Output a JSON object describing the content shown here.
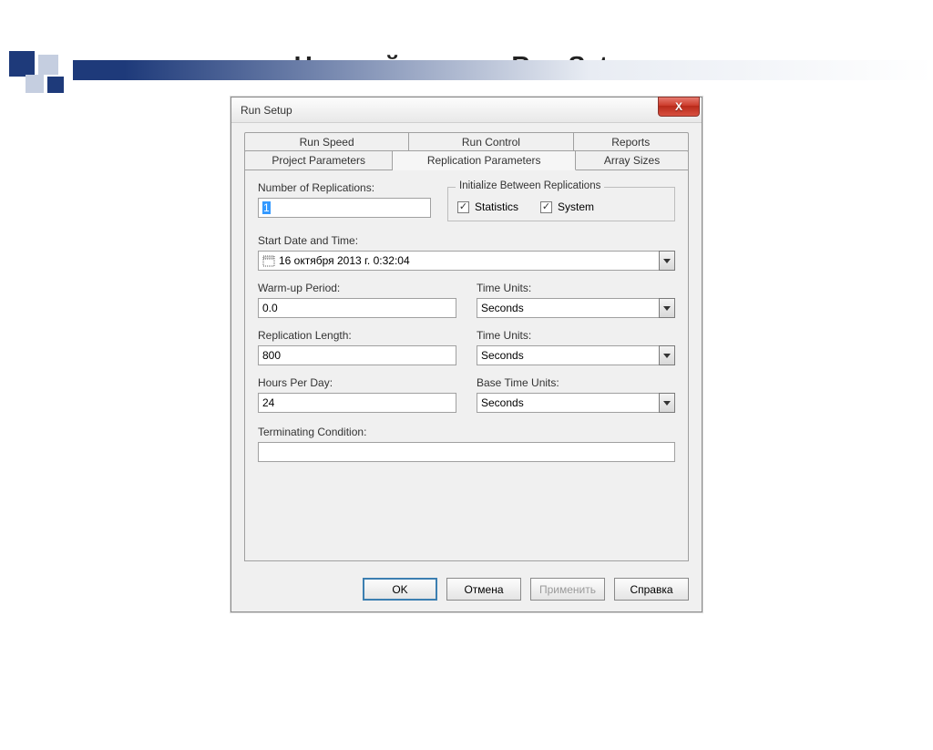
{
  "page_title": "Настройка меню Run Setup",
  "dialog": {
    "title": "Run Setup",
    "close_label": "X"
  },
  "tabs": {
    "row1": [
      "Run Speed",
      "Run Control",
      "Reports"
    ],
    "row2": [
      "Project Parameters",
      "Replication Parameters",
      "Array Sizes"
    ],
    "selected": "Replication Parameters"
  },
  "fields": {
    "num_replications_label": "Number of Replications:",
    "num_replications_value": "1",
    "init_group_title": "Initialize Between Replications",
    "chk_statistics": "Statistics",
    "chk_system": "System",
    "start_date_label": "Start Date and Time:",
    "start_date_value": "16 октября 2013 г.   0:32:04",
    "warmup_label": "Warm-up Period:",
    "warmup_value": "0.0",
    "warmup_units_label": "Time Units:",
    "warmup_units_value": "Seconds",
    "replen_label": "Replication Length:",
    "replen_value": "800",
    "replen_units_label": "Time Units:",
    "replen_units_value": "Seconds",
    "hpd_label": "Hours Per Day:",
    "hpd_value": "24",
    "base_units_label": "Base Time Units:",
    "base_units_value": "Seconds",
    "term_cond_label": "Terminating Condition:",
    "term_cond_value": ""
  },
  "buttons": {
    "ok": "OK",
    "cancel": "Отмена",
    "apply": "Применить",
    "help": "Справка"
  }
}
